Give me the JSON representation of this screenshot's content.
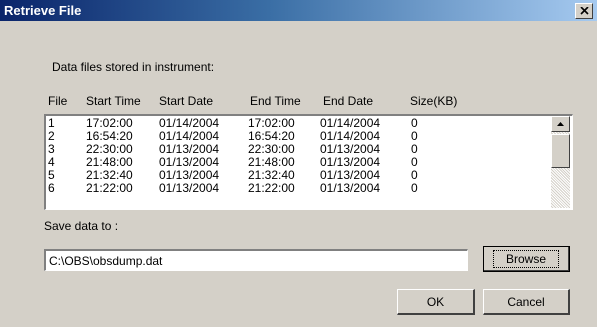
{
  "window": {
    "title": "Retrieve File",
    "close_icon": "close-icon"
  },
  "files_label": "Data files stored in instrument:",
  "columns": [
    "File",
    "Start Time",
    "Start Date",
    "End Time",
    "End Date",
    "Size(KB)"
  ],
  "rows": [
    [
      "1",
      "17:02:00",
      "01/14/2004",
      "17:02:00",
      "01/14/2004",
      "0"
    ],
    [
      "2",
      "16:54:20",
      "01/14/2004",
      "16:54:20",
      "01/14/2004",
      "0"
    ],
    [
      "3",
      "22:30:00",
      "01/13/2004",
      "22:30:00",
      "01/13/2004",
      "0"
    ],
    [
      "4",
      "21:48:00",
      "01/13/2004",
      "21:48:00",
      "01/13/2004",
      "0"
    ],
    [
      "5",
      "21:32:40",
      "01/13/2004",
      "21:32:40",
      "01/13/2004",
      "0"
    ],
    [
      "6",
      "21:22:00",
      "01/13/2004",
      "21:22:00",
      "01/13/2004",
      "0"
    ]
  ],
  "save_label": "Save data to :",
  "save_path": "C:\\OBS\\obsdump.dat",
  "buttons": {
    "browse": "Browse",
    "ok": "OK",
    "cancel": "Cancel"
  },
  "colors": {
    "face": "#d4d0c8",
    "title_start": "#0a246a",
    "title_end": "#a6caf0"
  }
}
